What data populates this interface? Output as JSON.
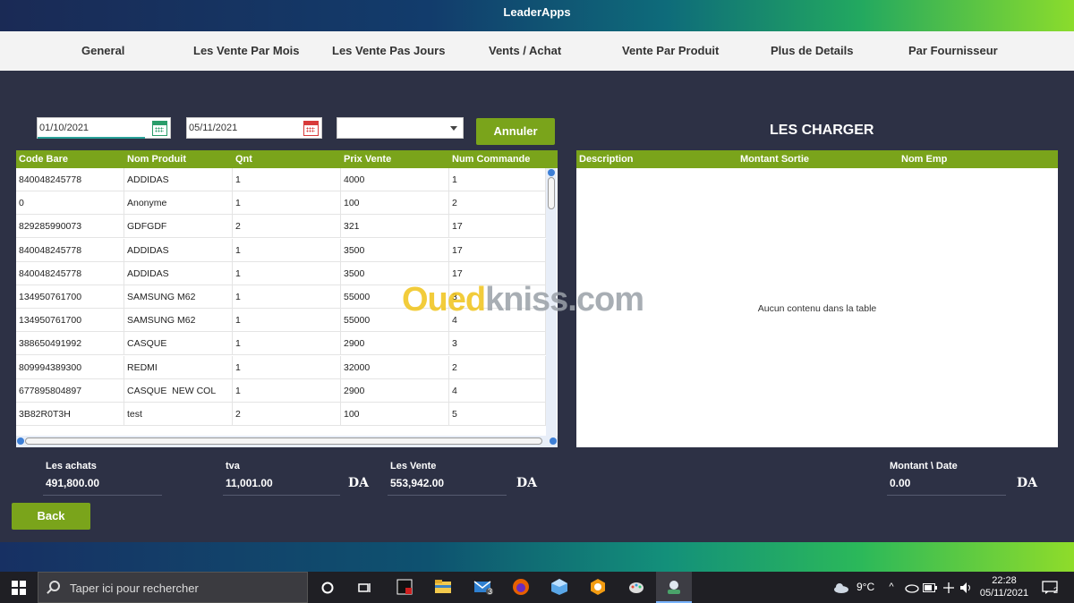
{
  "window": {
    "title": "LeaderApps"
  },
  "nav": [
    "General",
    "Les Vente Par Mois",
    "Les Vente Pas Jours",
    "Vents  /  Achat",
    "Vente Par Produit",
    "Plus de Details",
    "Par Fournisseur"
  ],
  "filters": {
    "date_from": "01/10/2021",
    "date_to": "05/11/2021",
    "combo_value": "",
    "cancel_label": "Annuler"
  },
  "sales_table": {
    "columns": [
      "Code Bare",
      "Nom Produit",
      "Qnt",
      "Prix Vente",
      "Num Commande"
    ],
    "rows": [
      [
        "840048245778",
        "ADDIDAS",
        "1",
        "4000",
        "1"
      ],
      [
        "0",
        "Anonyme",
        "1",
        "100",
        "2"
      ],
      [
        "829285990073",
        "GDFGDF",
        "2",
        "321",
        "17"
      ],
      [
        "840048245778",
        "ADDIDAS",
        "1",
        "3500",
        "17"
      ],
      [
        "840048245778",
        "ADDIDAS",
        "1",
        "3500",
        "17"
      ],
      [
        "134950761700",
        "SAMSUNG M62",
        "1",
        "55000",
        "3"
      ],
      [
        "134950761700",
        "SAMSUNG M62",
        "1",
        "55000",
        "4"
      ],
      [
        "388650491992",
        "CASQUE",
        "1",
        "2900",
        "3"
      ],
      [
        "809994389300",
        "REDMI",
        "1",
        "32000",
        "2"
      ],
      [
        "677895804897",
        "CASQUE  NEW COL",
        "1",
        "2900",
        "4"
      ],
      [
        "3B82R0T3H",
        "test",
        "2",
        "100",
        "5"
      ]
    ]
  },
  "charges": {
    "title": "LES CHARGER",
    "columns": [
      "Description",
      "Montant Sortie",
      "Nom Emp"
    ],
    "empty_message": "Aucun contenu dans la table"
  },
  "summary": {
    "achats_label": "Les achats",
    "achats_value": "491,800.00",
    "tva_label": "tva",
    "tva_value": "11,001.00",
    "vente_label": "Les Vente",
    "vente_value": "553,942.00",
    "montant_label": "Montant \\ Date",
    "montant_value": "0.00",
    "currency": "DA"
  },
  "back_label": "Back",
  "watermark": {
    "part1": "Oued",
    "part2": "kniss.com"
  },
  "taskbar": {
    "search_placeholder": "Taper ici pour rechercher",
    "weather": "9°C",
    "time": "22:28",
    "date": "05/11/2021",
    "mail_badge": "3",
    "notif_badge": "2"
  },
  "colors": {
    "accent": "#7aa41b",
    "background": "#2d3145"
  }
}
